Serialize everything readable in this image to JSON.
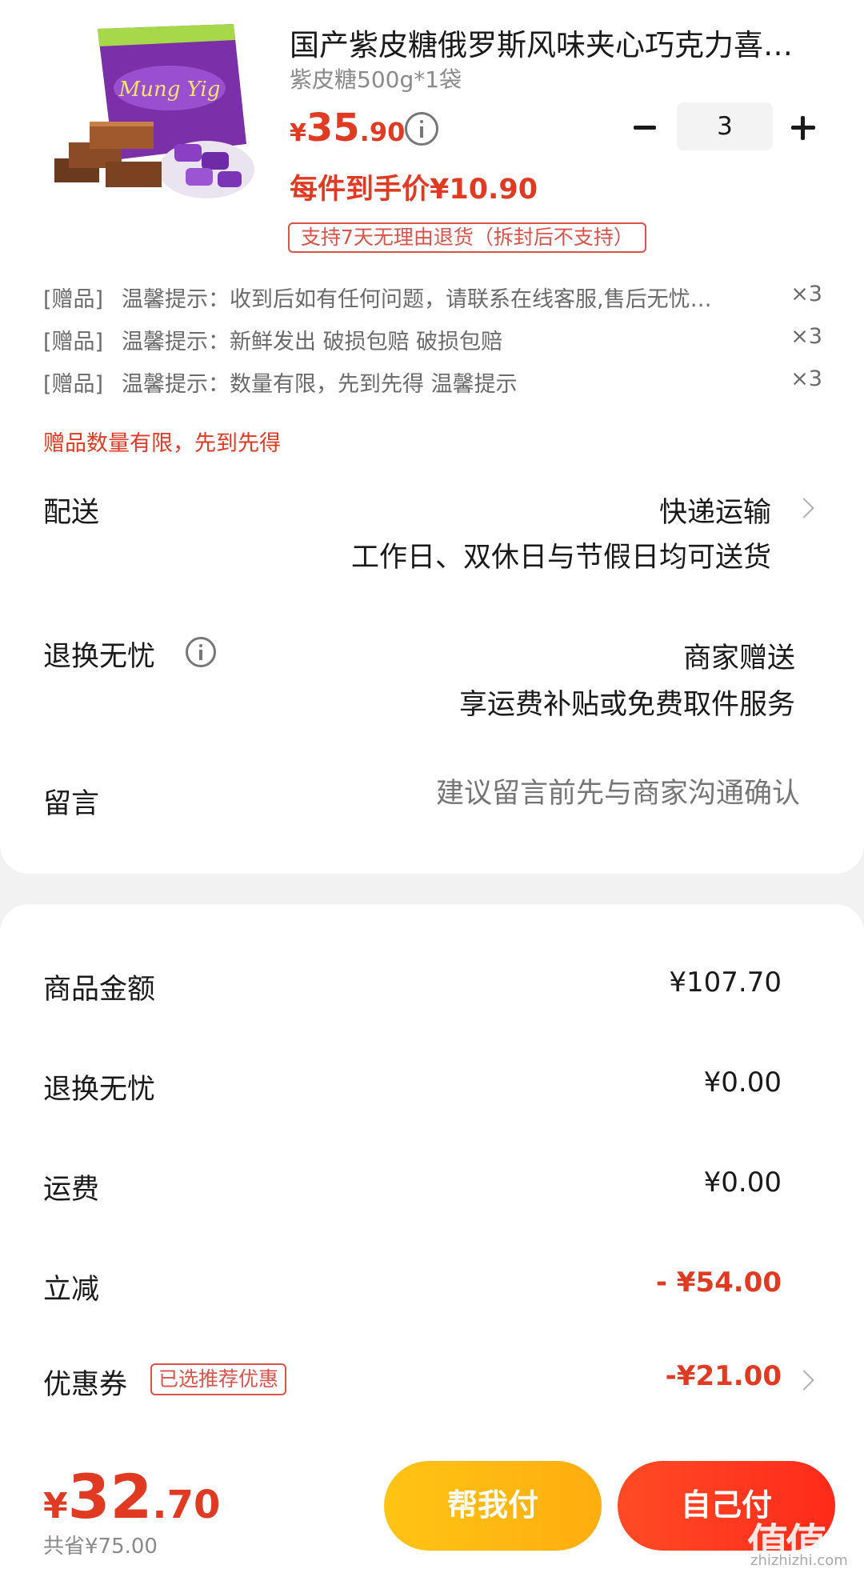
{
  "product": {
    "title": "国产紫皮糖俄罗斯风味夹心巧克力喜…",
    "spec": "紫皮糖500g*1袋",
    "price_currency": "¥",
    "price_int": "35",
    "price_dec": ".90",
    "unit_price": "每件到手价¥10.90",
    "return_tag": "支持7天无理由退货（拆封后不支持）",
    "quantity": "3",
    "thumb_brand": "Mung Yig"
  },
  "gifts": [
    {
      "tag": "[赠品]",
      "text": "温馨提示：收到后如有任何问题，请联系在线客服,售后无忧…",
      "count": "×3"
    },
    {
      "tag": "[赠品]",
      "text": "温馨提示：新鲜发出 破损包赔 破损包赔",
      "count": "×3"
    },
    {
      "tag": "[赠品]",
      "text": "温馨提示：数量有限，先到先得 温馨提示",
      "count": "×3"
    }
  ],
  "gift_note": "赠品数量有限，先到先得",
  "delivery": {
    "label": "配送",
    "method": "快递运输",
    "note": "工作日、双休日与节假日均可送货"
  },
  "return_service": {
    "label": "退换无忧",
    "value": "商家赠送",
    "note": "享运费补贴或免费取件服务"
  },
  "message": {
    "label": "留言",
    "placeholder": "建议留言前先与商家沟通确认"
  },
  "summary": {
    "goods_label": "商品金额",
    "goods_value": "¥107.70",
    "return_label": "退换无忧",
    "return_value": "¥0.00",
    "shipping_label": "运费",
    "shipping_value": "¥0.00",
    "discount_label": "立减",
    "discount_value": "- ¥54.00",
    "coupon_label": "优惠券",
    "coupon_tag": "已选推荐优惠",
    "coupon_value": "-¥21.00"
  },
  "footer": {
    "total_currency": "¥",
    "total_int": "32",
    "total_dec": ".70",
    "saved": "共省¥75.00",
    "help_pay": "帮我付",
    "self_pay": "自己付",
    "watermark": "值值值",
    "watermark_sub": "zhizhizhi.com"
  },
  "colors": {
    "accent_red": "#e03a23",
    "help_yellow": "#ffbe12",
    "self_red": "#ff3a20"
  }
}
